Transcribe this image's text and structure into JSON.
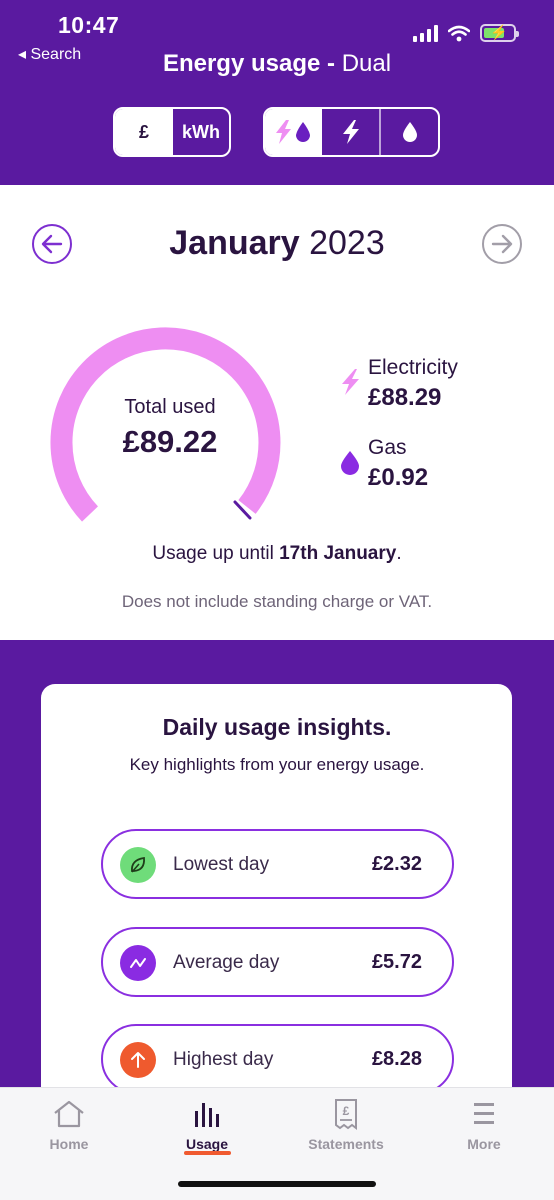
{
  "status_bar": {
    "time": "10:47",
    "back_label": "◂ Search"
  },
  "header": {
    "title_bold": "Energy usage - ",
    "title_regular": "Dual",
    "unit_toggle": {
      "pound_label": "£",
      "kwh_label": "kWh",
      "selected": "£"
    },
    "fuel_toggle": {
      "options": [
        "dual-icon",
        "electricity-icon",
        "gas-icon"
      ],
      "selected": "dual-icon"
    }
  },
  "month_selector": {
    "month": "January",
    "year": "2023"
  },
  "summary": {
    "total_label": "Total used",
    "total_value": "£89.22",
    "electricity_label": "Electricity",
    "electricity_value": "£88.29",
    "gas_label": "Gas",
    "gas_value": "£0.92",
    "usage_note_prefix": "Usage up until ",
    "usage_note_date": "17th January",
    "usage_note_suffix": ".",
    "disclaimer": "Does not include standing charge or VAT."
  },
  "insights": {
    "title": "Daily usage insights.",
    "subtitle": "Key highlights from your energy usage.",
    "items": [
      {
        "label": "Lowest day",
        "value": "£2.32",
        "icon": "leaf-icon",
        "color": "#6fdc7a"
      },
      {
        "label": "Average day",
        "value": "£5.72",
        "icon": "zigzag-icon",
        "color": "#8a2be2"
      },
      {
        "label": "Highest day",
        "value": "£8.28",
        "icon": "arrow-up-icon",
        "color": "#ef5a2e"
      }
    ]
  },
  "tabbar": {
    "items": [
      {
        "label": "Home",
        "icon": "home-icon"
      },
      {
        "label": "Usage",
        "icon": "bar-chart-icon"
      },
      {
        "label": "Statements",
        "icon": "receipt-icon"
      },
      {
        "label": "More",
        "icon": "menu-icon"
      }
    ],
    "selected": "Usage"
  },
  "colors": {
    "brand_purple": "#5a1aa0",
    "gauge_pink": "#ee8ef2",
    "accent_orange": "#f05a30"
  }
}
